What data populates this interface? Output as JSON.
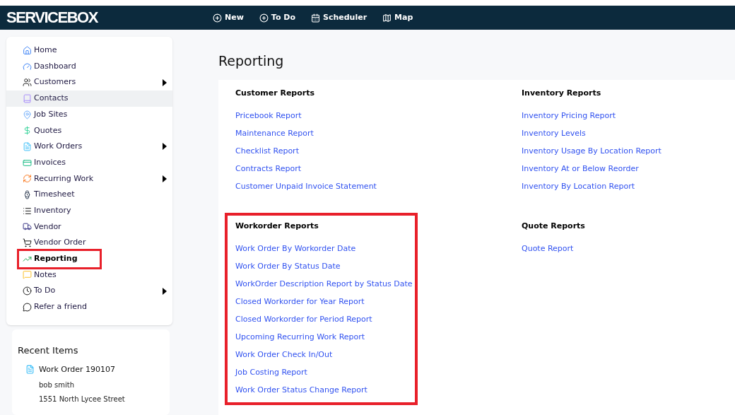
{
  "navbar": {
    "logo": "SERVICEBOX",
    "items": [
      {
        "label": "New"
      },
      {
        "label": "To Do"
      },
      {
        "label": "Scheduler"
      },
      {
        "label": "Map"
      }
    ]
  },
  "sidebar": {
    "items": [
      {
        "label": "Home",
        "selected": false,
        "hovered": false,
        "has_submenu": false,
        "highlighted": false
      },
      {
        "label": "Dashboard",
        "selected": false,
        "hovered": false,
        "has_submenu": false,
        "highlighted": false
      },
      {
        "label": "Customers",
        "selected": false,
        "hovered": false,
        "has_submenu": true,
        "highlighted": false
      },
      {
        "label": "Contacts",
        "selected": false,
        "hovered": true,
        "has_submenu": false,
        "highlighted": false
      },
      {
        "label": "Job Sites",
        "selected": false,
        "hovered": false,
        "has_submenu": false,
        "highlighted": false
      },
      {
        "label": "Quotes",
        "selected": false,
        "hovered": false,
        "has_submenu": false,
        "highlighted": false
      },
      {
        "label": "Work Orders",
        "selected": false,
        "hovered": false,
        "has_submenu": true,
        "highlighted": false
      },
      {
        "label": "Invoices",
        "selected": false,
        "hovered": false,
        "has_submenu": false,
        "highlighted": false
      },
      {
        "label": "Recurring Work",
        "selected": false,
        "hovered": false,
        "has_submenu": true,
        "highlighted": false
      },
      {
        "label": "Timesheet",
        "selected": false,
        "hovered": false,
        "has_submenu": false,
        "highlighted": false
      },
      {
        "label": "Inventory",
        "selected": false,
        "hovered": false,
        "has_submenu": false,
        "highlighted": false
      },
      {
        "label": "Vendor",
        "selected": false,
        "hovered": false,
        "has_submenu": false,
        "highlighted": false
      },
      {
        "label": "Vendor Order",
        "selected": false,
        "hovered": false,
        "has_submenu": false,
        "highlighted": false
      },
      {
        "label": "Reporting",
        "selected": true,
        "hovered": false,
        "has_submenu": false,
        "highlighted": true
      },
      {
        "label": "Notes",
        "selected": false,
        "hovered": false,
        "has_submenu": false,
        "highlighted": false
      },
      {
        "label": "To Do",
        "selected": false,
        "hovered": false,
        "has_submenu": true,
        "highlighted": false
      },
      {
        "label": "Refer a friend",
        "selected": false,
        "hovered": false,
        "has_submenu": false,
        "highlighted": false
      }
    ]
  },
  "recent_items": {
    "title": "Recent Items",
    "items": [
      {
        "title": "Work Order 190107",
        "lines": [
          "bob smith",
          "1551 North Lycee Street"
        ]
      }
    ]
  },
  "page_title": "Reporting",
  "sections": [
    {
      "title": "Customer Reports",
      "highlighted": false,
      "links": [
        "Pricebook Report",
        "Maintenance Report",
        "Checklist Report",
        "Contracts Report",
        "Customer Unpaid Invoice Statement"
      ]
    },
    {
      "title": "Inventory Reports",
      "highlighted": false,
      "links": [
        "Inventory Pricing Report",
        "Inventory Levels",
        "Inventory Usage By Location Report",
        "Inventory At or Below Reorder",
        "Inventory By Location Report"
      ]
    },
    {
      "title": "Workorder Reports",
      "highlighted": true,
      "links": [
        "Work Order By Workorder Date",
        "Work Order By Status Date",
        "WorkOrder Description Report by Status Date",
        "Closed Workorder for Year Report",
        "Closed Workorder for Period Report",
        "Upcoming Recurring Work Report",
        "Work Order Check In/Out",
        "Job Costing Report",
        "Work Order Status Change Report"
      ]
    },
    {
      "title": "Quote Reports",
      "highlighted": false,
      "links": [
        "Quote Report"
      ]
    }
  ]
}
